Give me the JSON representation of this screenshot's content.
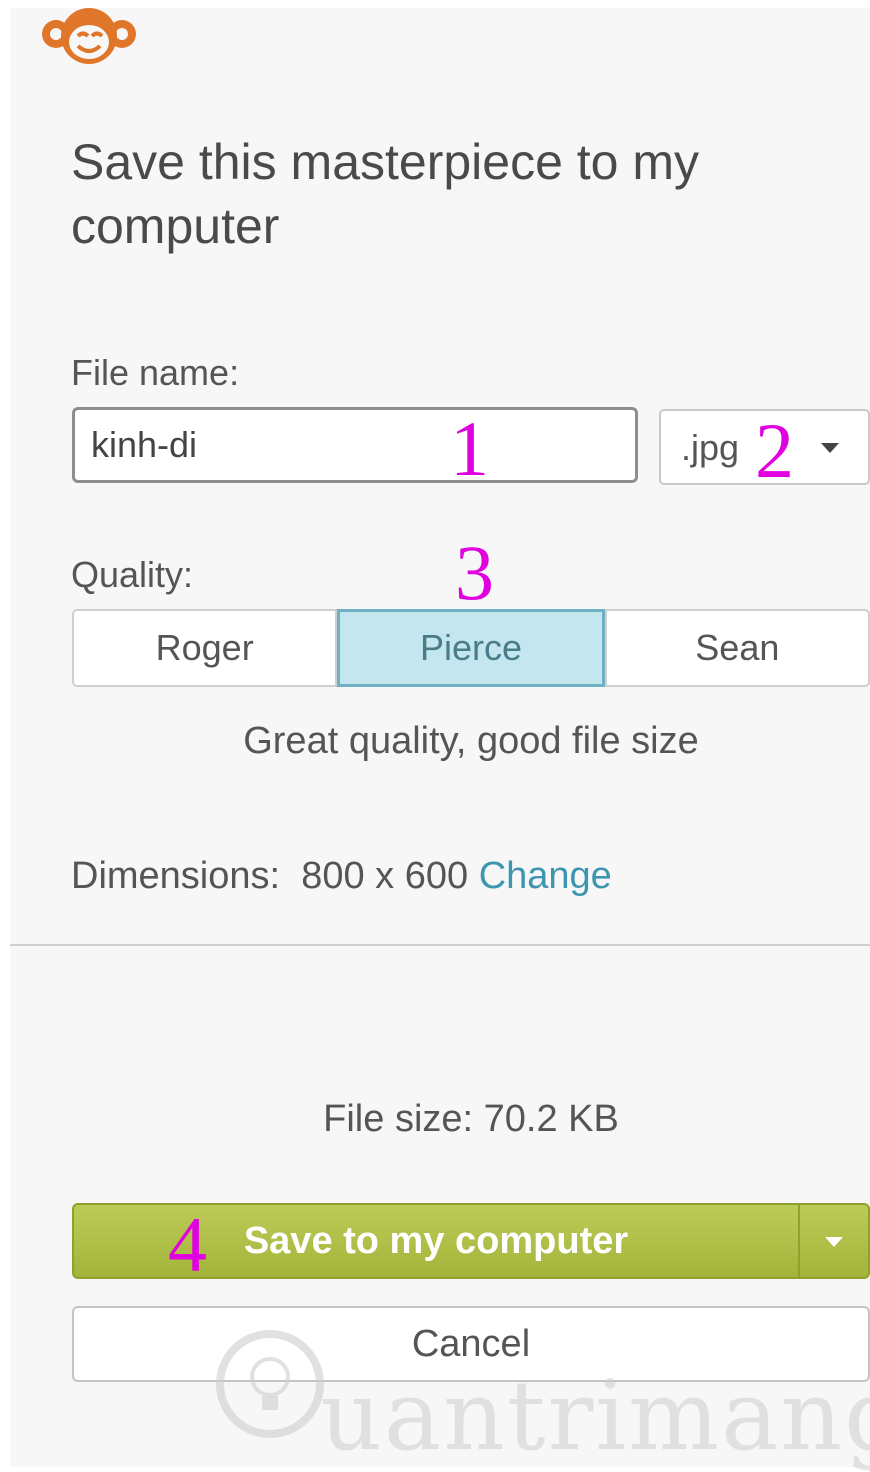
{
  "dialog": {
    "title": "Save this masterpiece to my computer",
    "file_name_label": "File name:",
    "file_name_value": "kinh-di",
    "format_value": ".jpg",
    "quality_label": "Quality:",
    "quality_options": [
      "Roger",
      "Pierce",
      "Sean"
    ],
    "quality_selected": "Pierce",
    "quality_description": "Great quality, good file size",
    "dimensions_label": "Dimensions:",
    "dimensions_value": "800 x 600",
    "change_link": "Change",
    "file_size": "File size: 70.2 KB",
    "save_button": "Save to my computer",
    "cancel_button": "Cancel"
  },
  "annotations": [
    "1",
    "2",
    "3",
    "4"
  ],
  "watermark": {
    "text": "uantrimang",
    "icon": "lightbulb-icon"
  },
  "colors": {
    "save_green": "#a8b93f",
    "link_blue": "#3d96b0",
    "selected_segment": "#c4e7ef",
    "annotation_magenta": "#e000e0"
  }
}
